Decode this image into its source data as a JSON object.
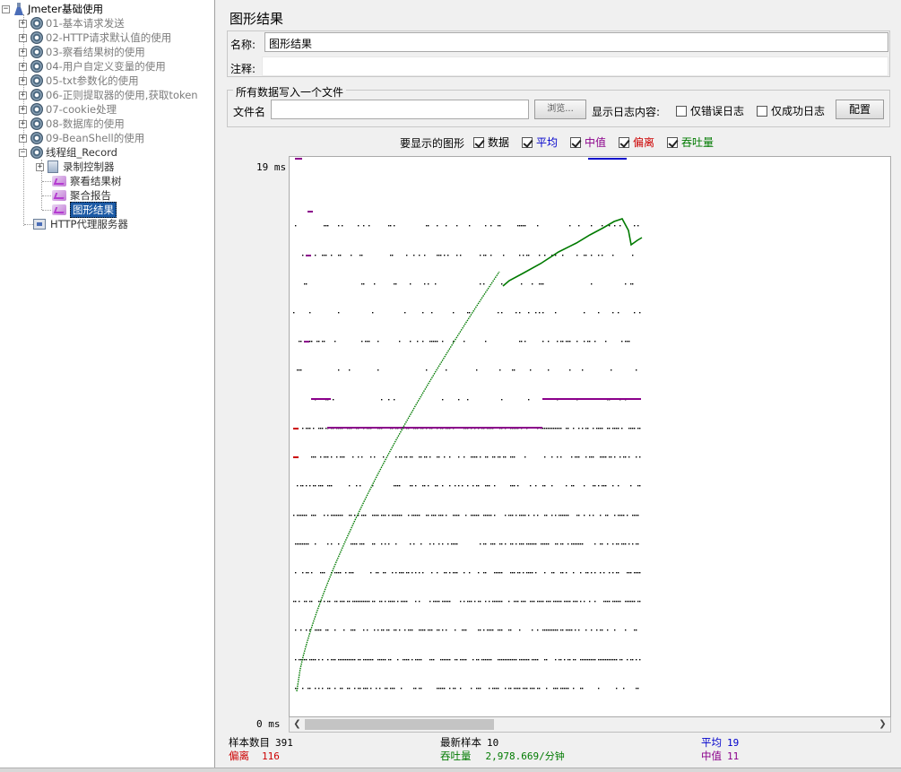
{
  "tree": {
    "root": "Jmeter基础使用",
    "items": [
      "01-基本请求发送",
      "02-HTTP请求默认值的使用",
      "03-察看结果树的使用",
      "04-用户自定义变量的使用",
      "05-txt参数化的使用",
      "06-正则提取器的使用,获取token",
      "07-cookie处理",
      "08-数据库的使用",
      "09-BeanShell的使用"
    ],
    "thread_group": "线程组_Record",
    "children": [
      "录制控制器",
      "察看结果树",
      "聚合报告",
      "图形结果"
    ],
    "proxy": "HTTP代理服务器"
  },
  "panel": {
    "title": "图形结果",
    "name_label": "名称:",
    "name_value": "图形结果",
    "comment_label": "注释:",
    "comment_value": "",
    "file_group_title": "所有数据写入一个文件",
    "filename_label": "文件名",
    "filename_value": "",
    "browse_button": "浏览...",
    "log_content_label": "显示日志内容:",
    "errors_only_label": "仅错误日志",
    "success_only_label": "仅成功日志",
    "config_button": "配置",
    "graphs_to_display_label": "要显示的图形",
    "show": {
      "data": "数据",
      "average": "平均",
      "median": "中值",
      "deviation": "偏离",
      "throughput": "吞吐量"
    },
    "y_max_label": "19 ms",
    "y_min_label": "0 ms"
  },
  "colors": {
    "data": "#000000",
    "average": "#0000cc",
    "median": "#8b008b",
    "deviation": "#cc0000",
    "throughput": "#007a00",
    "selection": "#1c5aa5"
  },
  "stats": {
    "sample_count_label": "样本数目",
    "sample_count": "391",
    "latest_sample_label": "最新样本",
    "latest_sample": "10",
    "average_label": "平均",
    "average": "19",
    "deviation_label": "偏离",
    "deviation": "116",
    "throughput_label": "吞吐量",
    "throughput": "2,978.669/分钟",
    "median_label": "中值",
    "median": "11"
  },
  "chart_data": {
    "type": "scatter",
    "ylim": [
      0,
      19
    ],
    "y_unit": "ms",
    "x": "sample index",
    "sample_count": 391,
    "series": [
      {
        "name": "数据",
        "values_ms": [
          10,
          12,
          14,
          11,
          9,
          13,
          8,
          15,
          10,
          11,
          12,
          16,
          9,
          10,
          14,
          7,
          11,
          13,
          12,
          10
        ]
      },
      {
        "name": "中值",
        "values_ms": [
          11,
          11,
          11,
          12,
          12,
          12
        ]
      },
      {
        "name": "吞吐量",
        "trend": "rising from low to high values across samples, with a drop near the end"
      }
    ]
  }
}
